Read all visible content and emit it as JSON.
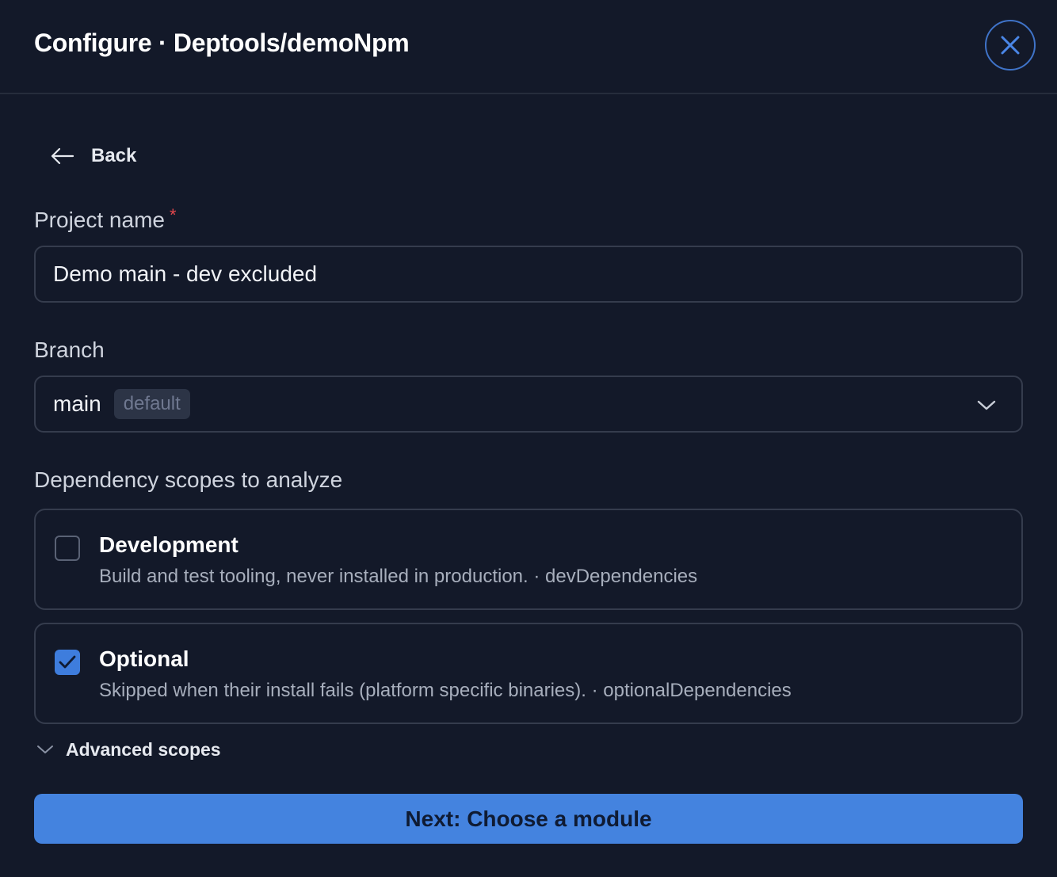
{
  "header": {
    "title": "Configure · Deptools/demoNpm",
    "close_icon": "close-icon"
  },
  "back": {
    "label": "Back",
    "icon": "arrow-left-icon"
  },
  "project_name": {
    "label": "Project name",
    "required_marker": "*",
    "value": "Demo main - dev excluded"
  },
  "branch": {
    "label": "Branch",
    "value": "main",
    "badge": "default",
    "icon": "chevron-down-icon"
  },
  "scopes": {
    "label": "Dependency scopes to analyze",
    "items": [
      {
        "title": "Development",
        "description": "Build and test tooling, never installed in production. · devDependencies",
        "checked": false
      },
      {
        "title": "Optional",
        "description": "Skipped when their install fails (platform specific binaries). · optionalDependencies",
        "checked": true
      }
    ]
  },
  "advanced": {
    "label": "Advanced scopes",
    "icon": "chevron-down-icon"
  },
  "next_button": {
    "label": "Next: Choose a module"
  },
  "colors": {
    "accent": "#4483df",
    "background": "#131929",
    "required": "#e5484d"
  }
}
